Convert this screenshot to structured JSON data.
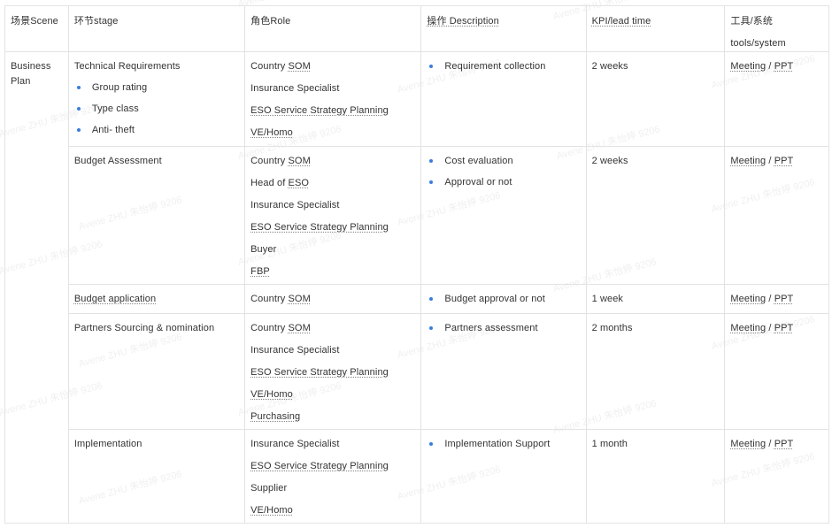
{
  "watermark": "Avene ZHU 朱怡婷 9206",
  "headers": [
    "场景Scene",
    "环节stage",
    "角色Role",
    "操作 Description",
    "KPI/lead time",
    "工具/系统",
    "tools/system"
  ],
  "scene": [
    "Business",
    "Plan"
  ],
  "rows": [
    {
      "stage": "Technical Requirements",
      "stage_items": [
        "Group rating",
        "Type class",
        "Anti- theft"
      ],
      "roles": [
        "Country SOM",
        "Insurance Specialist",
        "ESO Service Strategy Planning",
        "VE/Homo"
      ],
      "desc": [
        "Requirement collection"
      ],
      "kpi": "2 weeks",
      "tool_a": "Meeting",
      "tool_sep": " / ",
      "tool_b": "PPT"
    },
    {
      "stage": "Budget Assessment",
      "stage_items": [],
      "roles": [
        "Country SOM",
        "Head of ESO",
        "Insurance Specialist",
        "ESO Service Strategy Planning",
        "Buyer",
        "FBP"
      ],
      "desc": [
        "Cost evaluation",
        "Approval or not"
      ],
      "kpi": "2 weeks",
      "tool_a": "Meeting",
      "tool_sep": " / ",
      "tool_b": "PPT"
    },
    {
      "stage": "Budget application",
      "stage_items": [],
      "roles": [
        "Country SOM"
      ],
      "desc": [
        "Budget approval or not"
      ],
      "kpi": "1 week",
      "tool_a": "Meeting",
      "tool_sep": " / ",
      "tool_b": "PPT"
    },
    {
      "stage": "Partners Sourcing & nomination",
      "stage_items": [],
      "roles": [
        "Country SOM",
        "Insurance Specialist",
        "ESO Service Strategy Planning",
        "VE/Homo",
        "Purchasing"
      ],
      "desc": [
        "Partners assessment"
      ],
      "kpi": "2 months",
      "tool_a": "Meeting",
      "tool_sep": " / ",
      "tool_b": "PPT"
    },
    {
      "stage": "Implementation",
      "stage_items": [],
      "roles": [
        "Insurance Specialist",
        "ESO Service Strategy Planning",
        "Supplier",
        "VE/Homo"
      ],
      "desc": [
        "Implementation Support"
      ],
      "kpi": "1 month",
      "tool_a": "Meeting",
      "tool_sep": " / ",
      "tool_b": "PPT"
    }
  ]
}
